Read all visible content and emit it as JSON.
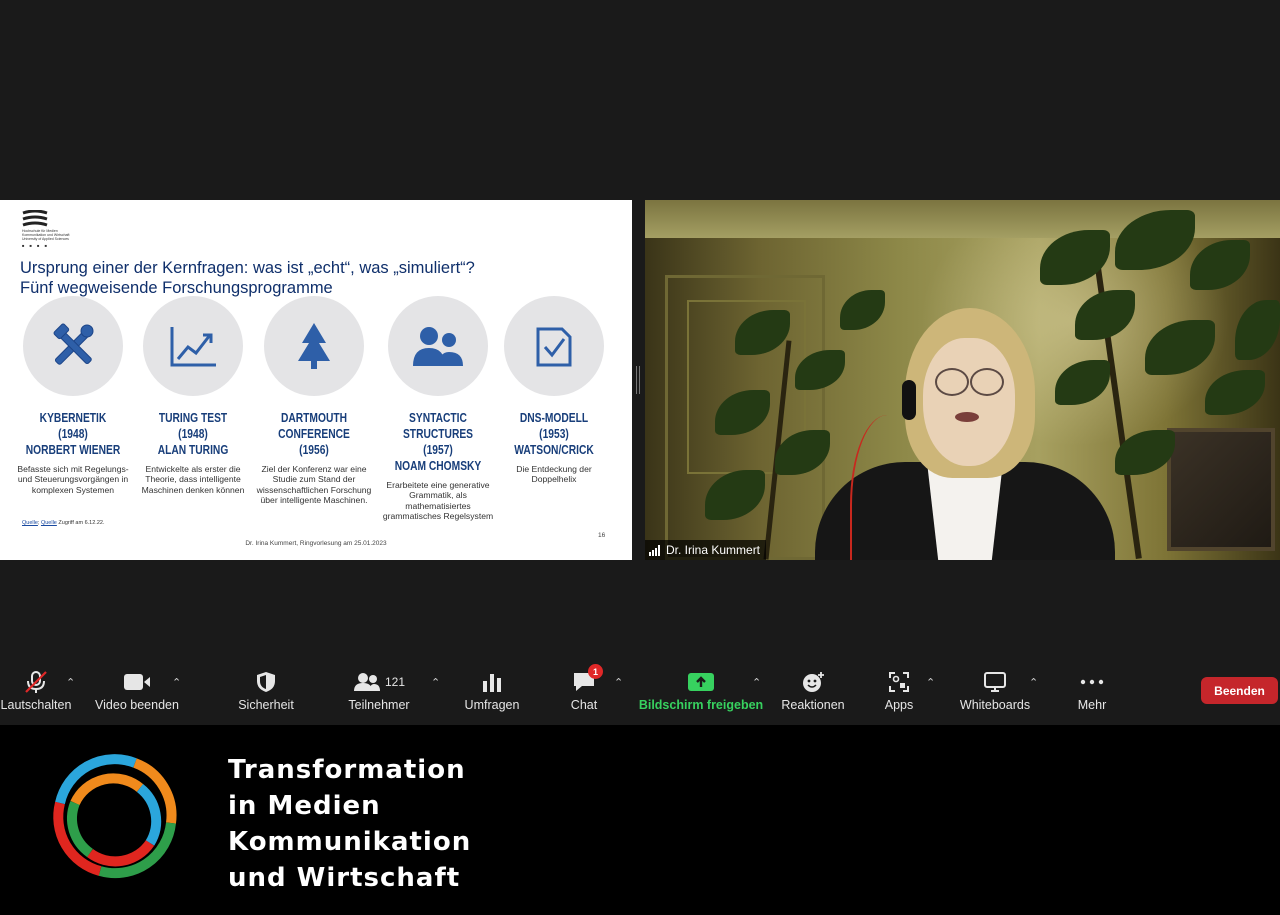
{
  "slide": {
    "logo_text_lines": [
      "Hochschule für Medien",
      "Kommunikation und Wirtschaft",
      "University of Applied Sciences"
    ],
    "logo_dots": "■ ■ ■ ■",
    "title_line1": "Ursprung einer der Kernfragen: was ist „echt“, was „simuliert“?",
    "title_line2": "Fünf wegweisende Forschungsprogramme",
    "columns": [
      {
        "icon": "tools-icon",
        "heading_lines": [
          "KYBERNETIK (1948)",
          "NORBERT WIENER"
        ],
        "description": "Befasste sich mit Regelungs- und Steuerungsvorgängen in komplexen Systemen"
      },
      {
        "icon": "trend-chart-icon",
        "heading_lines": [
          "TURING TEST (1948)",
          "ALAN TURING"
        ],
        "description": "Entwickelte als erster die Theorie, dass intelligente Maschinen denken können"
      },
      {
        "icon": "tree-icon",
        "heading_lines": [
          "DARTMOUTH",
          "CONFERENCE (1956)"
        ],
        "description": "Ziel der Konferenz war eine Studie zum Stand der wissenschaftlichen Forschung über intelligente Maschinen."
      },
      {
        "icon": "people-icon",
        "heading_lines": [
          "SYNTACTIC",
          "STRUCTURES (1957)",
          "NOAM CHOMSKY"
        ],
        "description": "Erarbeitete eine generative Grammatik, als mathematisiertes grammatisches Regelsystem"
      },
      {
        "icon": "checklist-icon",
        "heading_lines": [
          "DNS-MODELL (1953)",
          "WATSON/CRICK"
        ],
        "description": "Die Entdeckung der Doppelhelix"
      }
    ],
    "source_link1": "Quelle",
    "source_link2": "Quelle",
    "source_suffix": " Zugriff am 6.12.22.",
    "footer": "Dr. Irina Kummert, Ringvorlesung am 25.01.2023",
    "page_number": "16"
  },
  "video": {
    "participant_name": "Dr. Irina Kummert"
  },
  "toolbar": {
    "mute_label": "Lautschalten",
    "video_label": "Video beenden",
    "security_label": "Sicherheit",
    "participants_label": "Teilnehmer",
    "participants_count": "121",
    "polls_label": "Umfragen",
    "chat_label": "Chat",
    "chat_badge": "1",
    "share_label": "Bildschirm freigeben",
    "reactions_label": "Reaktionen",
    "apps_label": "Apps",
    "whiteboards_label": "Whiteboards",
    "more_label": "Mehr",
    "end_label": "Beenden",
    "colors": {
      "share_green": "#37d15f",
      "end_red": "#c5262b",
      "badge_red": "#e02828"
    }
  },
  "banner": {
    "lines": [
      "Transformation",
      "in Medien",
      "Kommunikation",
      "und Wirtschaft"
    ],
    "ring_colors": [
      "#2ba6dc",
      "#f08a1c",
      "#2e9e4a",
      "#e0261f"
    ]
  }
}
